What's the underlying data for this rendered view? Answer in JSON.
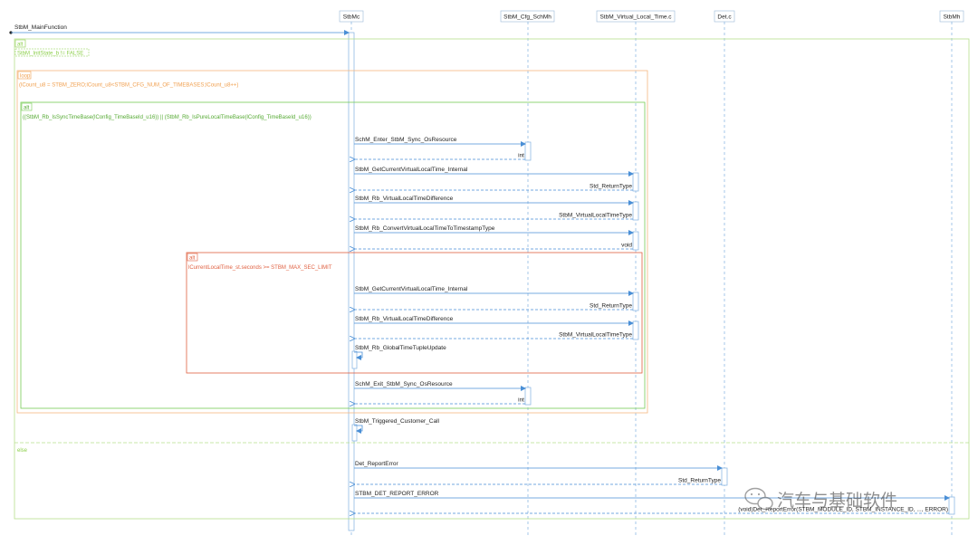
{
  "participants": [
    {
      "id": "stbmc",
      "label": "StbMc"
    },
    {
      "id": "cfg",
      "label": "StbM_Cfg_SchMh"
    },
    {
      "id": "vlt",
      "label": "StbM_Virtual_Local_Time.c"
    },
    {
      "id": "det",
      "label": "Det.c"
    },
    {
      "id": "stbmh",
      "label": "StbMh"
    }
  ],
  "entry": {
    "label": "StbM_MainFunction"
  },
  "frames": {
    "alt_outer": {
      "tag": "alt",
      "condition": "StbM_InitState_b != FALSE",
      "color": "#8ccf4a"
    },
    "loop": {
      "tag": "loop",
      "condition": "(lCount_u8 = STBM_ZERO;lCount_u8<STBM_CFG_NUM_OF_TIMEBASES;lCount_u8++)",
      "color": "#f0a050"
    },
    "alt_inner": {
      "tag": "alt",
      "condition": "((StbM_Rb_IsSyncTimeBase(lConfig_TimeBaseId_u16)) || (StbM_Rb_IsPureLocalTimeBase(lConfig_TimeBaseId_u16))",
      "color": "#77cc55"
    },
    "alt_red": {
      "tag": "alt",
      "condition": "lCurrentLocalTime_st.seconds >= STBM_MAX_SEC_LIMIT",
      "color": "#e06040"
    },
    "else": {
      "tag": "else",
      "color": "#8ccf4a"
    }
  },
  "messages": [
    {
      "call": "SchM_Enter_StbM_Sync_OsResource",
      "ret": "int"
    },
    {
      "call": "StbM_GetCurrentVirtualLocalTime_Internal",
      "ret": "Std_ReturnType"
    },
    {
      "call": "StbM_Rb_VirtualLocalTimeDifference",
      "ret": "StbM_VirtualLocalTimeType"
    },
    {
      "call": "StbM_Rb_ConvertVirtualLocalTimeToTimestampType",
      "ret": "void"
    },
    {
      "call": "StbM_GetCurrentVirtualLocalTime_Internal",
      "ret": "Std_ReturnType"
    },
    {
      "call": "StbM_Rb_VirtualLocalTimeDifference",
      "ret": "StbM_VirtualLocalTimeType"
    },
    {
      "call": "StbM_Rb_GlobalTimeTupleUpdate"
    },
    {
      "call": "SchM_Exit_StbM_Sync_OsResource",
      "ret": "int"
    },
    {
      "call": "StbM_Triggered_Customer_Call"
    },
    {
      "call": "Det_ReportError",
      "ret": "Std_ReturnType"
    },
    {
      "call": "STBM_DET_REPORT_ERROR",
      "ret": "(void)Det_ReportError(STBM_MODULE_ID, STBM_INSTANCE_ID, ..., ERROR)"
    }
  ],
  "watermark": {
    "text": "汽车与基础软件",
    "icon": "wechat-icon"
  }
}
